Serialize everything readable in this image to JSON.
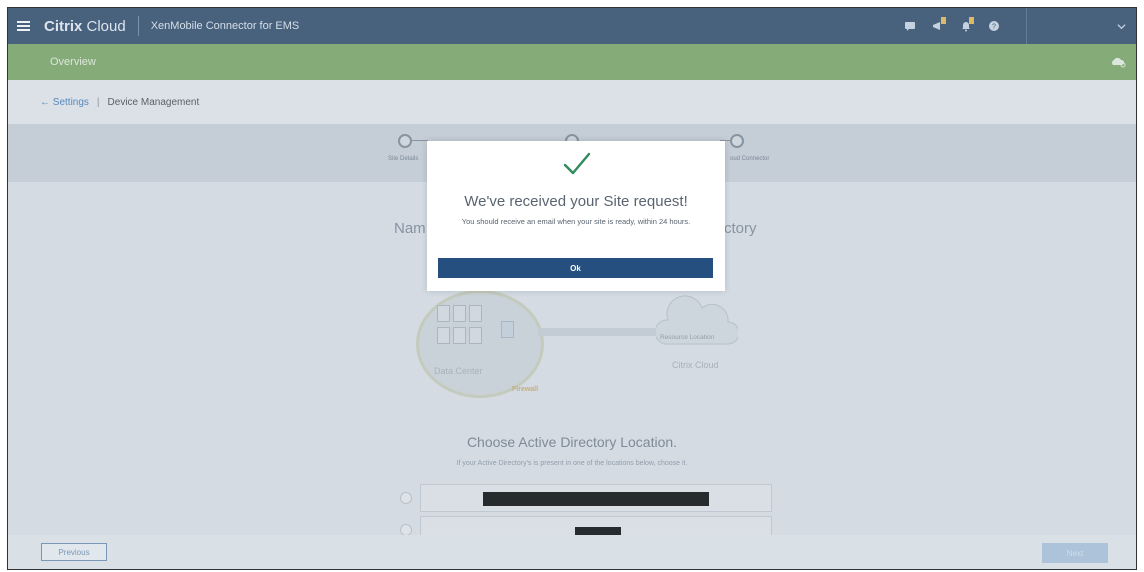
{
  "topbar": {
    "brand_bold": "Citrix",
    "brand_rest": " Cloud",
    "product": "XenMobile Connector for EMS",
    "icons": [
      "chat-icon",
      "megaphone-icon",
      "bell-icon",
      "help-icon",
      "chevron-down-icon"
    ]
  },
  "greenbar": {
    "overview": "Overview",
    "icon": "cloud-settings-icon"
  },
  "breadcrumb": {
    "back": "Settings",
    "separator": "|",
    "current": "Device Management"
  },
  "steps": [
    {
      "label": "Site Details"
    },
    {
      "label": ""
    },
    {
      "label": "oud Connector"
    }
  ],
  "main": {
    "heading_left": "Nam",
    "heading_right": "ctory",
    "diagram": {
      "datacenter_label": "Data Center",
      "firewall_label": "Firewall",
      "resource_location": "Resource Location",
      "citrix_cloud": "Citrix Cloud"
    },
    "choose_title": "Choose Active Directory Location.",
    "choose_subtitle": "If your Active Directory's is present in one of the locations below, choose it."
  },
  "footer": {
    "previous": "Previous",
    "next": "Next"
  },
  "modal": {
    "title": "We've received your Site request!",
    "message": "You should receive an email when your site is ready, within 24 hours.",
    "ok": "Ok"
  },
  "colors": {
    "topbar": "#2a4665",
    "greenbar": "#78a55f",
    "ok_button": "#244f7e",
    "check": "#2f8a5c"
  }
}
